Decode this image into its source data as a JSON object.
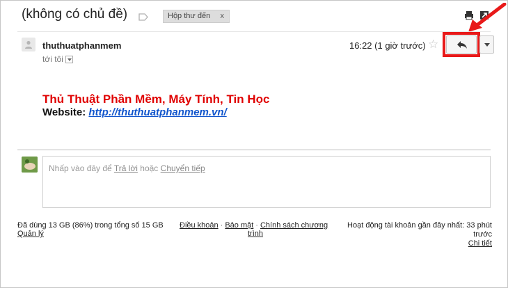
{
  "header": {
    "subject": "(không có chủ đề)",
    "label_chip": "Hộp thư đến",
    "label_chip_close": "x",
    "icons": [
      "label-icon",
      "print-icon",
      "open-new-window-icon"
    ]
  },
  "message": {
    "sender": "thuthuatphanmem",
    "to": "tới tôi",
    "timestamp": "16:22 (1 giờ trước)",
    "star_icon": "star-icon",
    "reply_icon": "reply-icon",
    "more_icon": "chevron-down-icon",
    "body": {
      "line1": "Thủ Thuật Phần Mềm, Máy Tính, Tin Học",
      "website_label": "Website",
      "website_colon": ": ",
      "website_url": "http://thuthuatphanmem.vn/"
    }
  },
  "reply_box": {
    "prefix": "Nhấp vào đây để ",
    "reply_link": "Trả lời",
    "middle": " hoặc ",
    "forward_link": "Chuyển tiếp"
  },
  "footer": {
    "quota": "Đã dùng 13 GB (86%) trong tổng số 15 GB",
    "manage": "Quản lý",
    "terms": "Điều khoản",
    "privacy": "Bảo mật",
    "policy_line1": "Chính sách chương",
    "policy_line2": "trình",
    "sep": "·",
    "activity_line1": "Hoạt động tài khoản gần đây nhất: 33 phút",
    "activity_line2": "trước",
    "details": "Chi tiết"
  },
  "colors": {
    "highlight": "#e81919",
    "link": "#1155cc",
    "headline": "#e00000"
  }
}
